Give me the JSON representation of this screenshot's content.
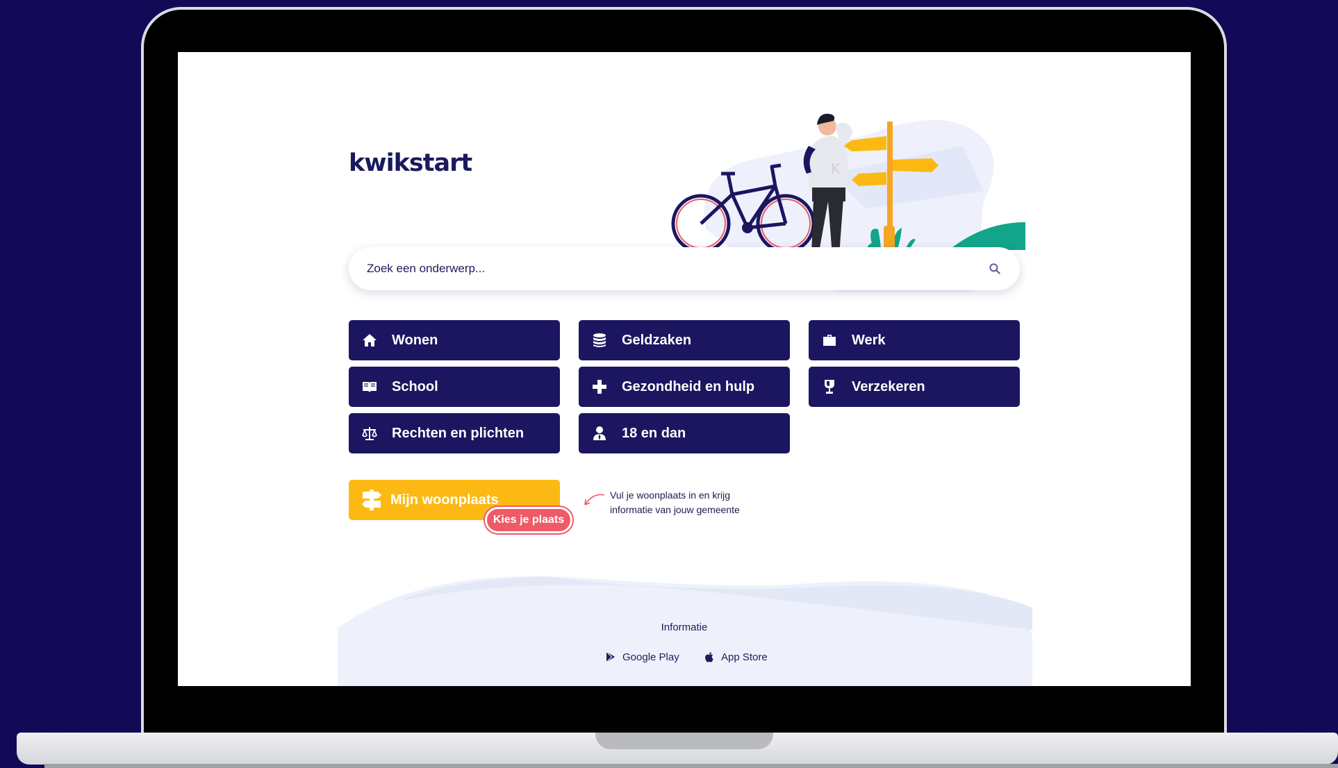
{
  "brand": {
    "logo_text": "kwikstart"
  },
  "search": {
    "placeholder": "Zoek een onderwerp..."
  },
  "categories": [
    {
      "label": "Wonen",
      "icon": "home-icon"
    },
    {
      "label": "Geldzaken",
      "icon": "coins-icon"
    },
    {
      "label": "Werk",
      "icon": "briefcase-icon"
    },
    {
      "label": "School",
      "icon": "book-icon"
    },
    {
      "label": "Gezondheid en hulp",
      "icon": "plus-icon"
    },
    {
      "label": "Verzekeren",
      "icon": "glass-icon"
    },
    {
      "label": "Rechten en plichten",
      "icon": "scale-icon"
    },
    {
      "label": "18 en dan",
      "icon": "person-icon"
    }
  ],
  "woonplaats": {
    "label": "Mijn woonplaats",
    "icon": "signpost-icon",
    "pill_label": "Kies je plaats",
    "hint": "Vul je woonplaats in en krijg informatie van jouw gemeente"
  },
  "footer": {
    "title": "Informatie",
    "google_play": "Google Play",
    "app_store": "App Store"
  },
  "colors": {
    "background": "#130a57",
    "button": "#1c1660",
    "accent": "#fdb913",
    "pill": "#ee5a67"
  }
}
